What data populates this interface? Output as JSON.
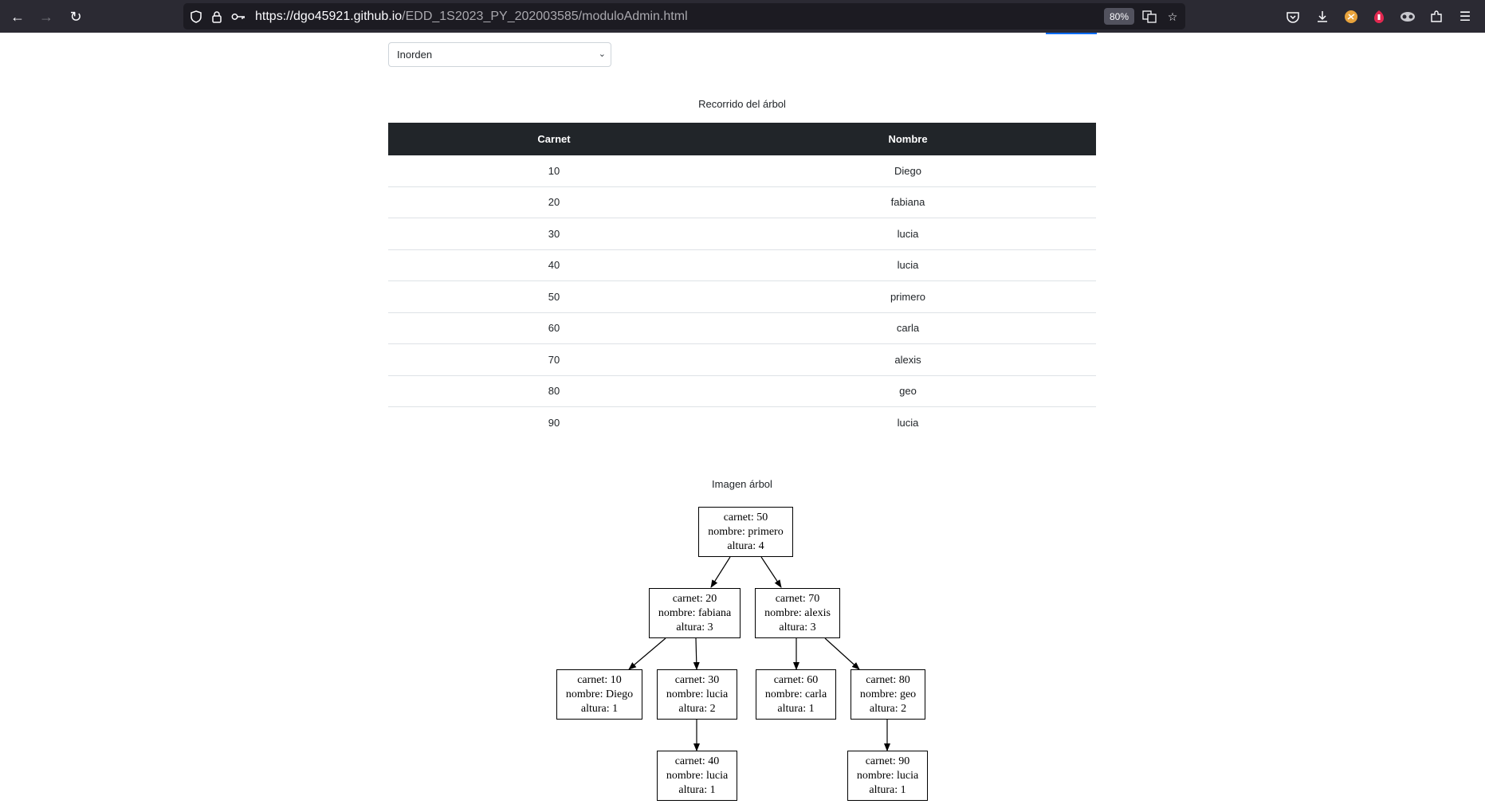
{
  "browser": {
    "url_host": "https://dgo45921.github.io",
    "url_path": "/EDD_1S2023_PY_202003585/moduloAdmin.html",
    "zoom": "80%"
  },
  "controls": {
    "traversal_select": "Inorden"
  },
  "table_section": {
    "caption": "Recorrido del árbol",
    "headers": [
      "Carnet",
      "Nombre"
    ],
    "rows": [
      [
        "10",
        "Diego"
      ],
      [
        "20",
        "fabiana"
      ],
      [
        "30",
        "lucia"
      ],
      [
        "40",
        "lucia"
      ],
      [
        "50",
        "primero"
      ],
      [
        "60",
        "carla"
      ],
      [
        "70",
        "alexis"
      ],
      [
        "80",
        "geo"
      ],
      [
        "90",
        "lucia"
      ]
    ]
  },
  "tree_section": {
    "caption": "Imagen árbol",
    "nodes": [
      {
        "id": "n50",
        "line1": "carnet: 50",
        "line2": "nombre: primero",
        "line3": "altura: 4"
      },
      {
        "id": "n20",
        "line1": "carnet: 20",
        "line2": "nombre: fabiana",
        "line3": "altura: 3"
      },
      {
        "id": "n70",
        "line1": "carnet: 70",
        "line2": "nombre: alexis",
        "line3": "altura: 3"
      },
      {
        "id": "n10",
        "line1": "carnet: 10",
        "line2": "nombre: Diego",
        "line3": "altura: 1"
      },
      {
        "id": "n30",
        "line1": "carnet: 30",
        "line2": "nombre: lucia",
        "line3": "altura: 2"
      },
      {
        "id": "n60",
        "line1": "carnet: 60",
        "line2": "nombre: carla",
        "line3": "altura: 1"
      },
      {
        "id": "n80",
        "line1": "carnet: 80",
        "line2": "nombre: geo",
        "line3": "altura: 2"
      },
      {
        "id": "n40",
        "line1": "carnet: 40",
        "line2": "nombre: lucia",
        "line3": "altura: 1"
      },
      {
        "id": "n90",
        "line1": "carnet: 90",
        "line2": "nombre: lucia",
        "line3": "altura: 1"
      }
    ]
  }
}
